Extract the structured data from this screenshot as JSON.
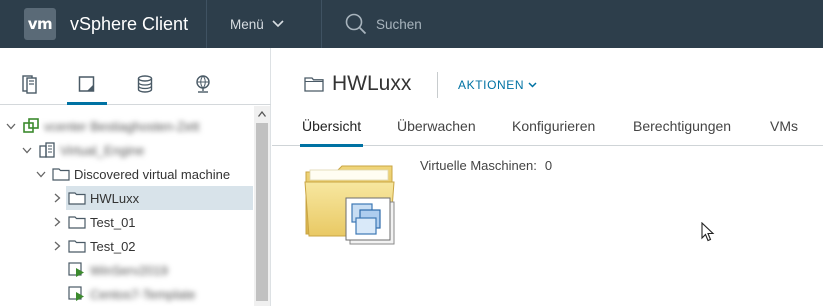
{
  "header": {
    "logo": "vm",
    "app_title": "vSphere Client",
    "menu_label": "Menü",
    "search_placeholder": "Suchen"
  },
  "nav_tabs": [
    {
      "icon": "hosts-clusters-icon",
      "active": false
    },
    {
      "icon": "vms-templates-icon",
      "active": true
    },
    {
      "icon": "storage-icon",
      "active": false
    },
    {
      "icon": "networking-icon",
      "active": false
    }
  ],
  "tree": {
    "items": [
      {
        "label": "vcenter Bestiaghosten-Zett",
        "blurred": true,
        "icon": "vcenter-icon",
        "expanded": true
      },
      {
        "label": "Virtual_Engine",
        "blurred": true,
        "icon": "datacenter-icon",
        "expanded": true
      },
      {
        "label": "Discovered virtual machine",
        "blurred": false,
        "icon": "folder-icon",
        "expanded": true
      },
      {
        "label": "HWLuxx",
        "blurred": false,
        "icon": "folder-icon",
        "expanded": false,
        "selected": true
      },
      {
        "label": "Test_01",
        "blurred": false,
        "icon": "folder-icon",
        "expanded": false
      },
      {
        "label": "Test_02",
        "blurred": false,
        "icon": "folder-icon",
        "expanded": false
      },
      {
        "label": "WinServ2019",
        "blurred": true,
        "icon": "vm-running-icon"
      },
      {
        "label": "Centos7-Template",
        "blurred": true,
        "icon": "vm-running-icon"
      }
    ]
  },
  "object": {
    "title": "HWLuxx",
    "actions_label": "AKTIONEN",
    "tabs": [
      "Übersicht",
      "Überwachen",
      "Konfigurieren",
      "Berechtigungen",
      "VMs"
    ],
    "active_tab": "Übersicht",
    "summary": {
      "vm_label": "Virtuelle Maschinen:",
      "vm_count": "0"
    }
  },
  "colors": {
    "header_bg": "#2d3e4b",
    "accent": "#0072a3",
    "selection_bg": "#d8e3ea"
  }
}
